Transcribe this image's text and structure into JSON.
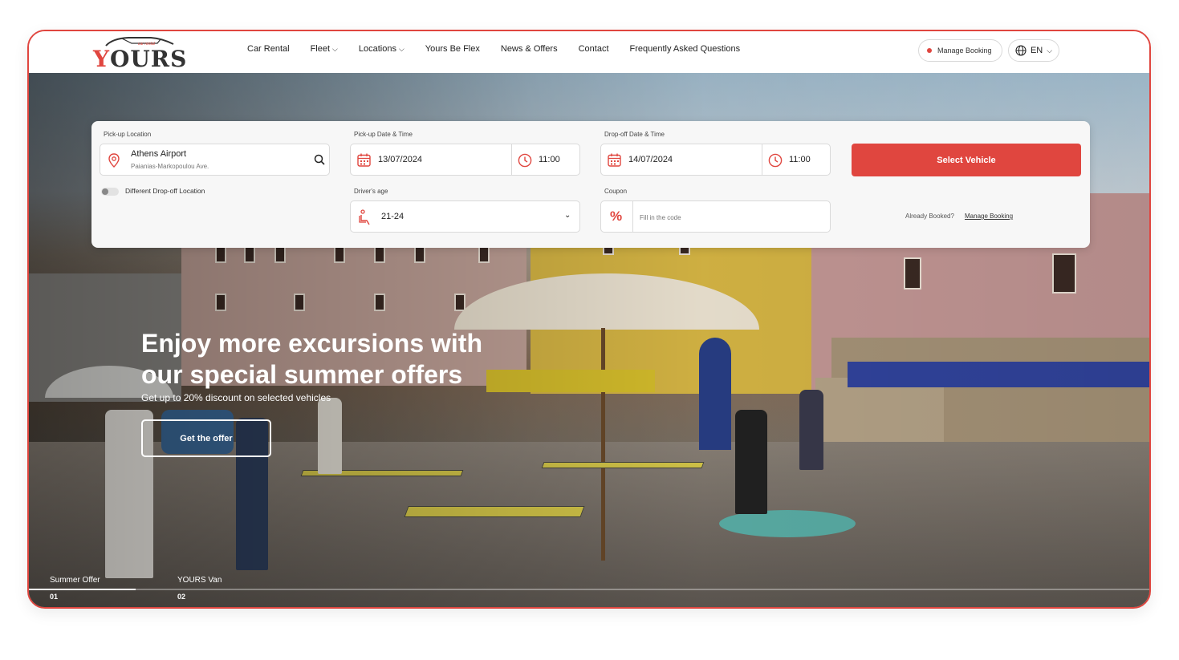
{
  "brand": {
    "name": "YOURS",
    "tagline": "car rental",
    "accent": "#e0463f"
  },
  "nav": {
    "items": [
      {
        "label": "Car Rental",
        "dropdown": false
      },
      {
        "label": "Fleet",
        "dropdown": true
      },
      {
        "label": "Locations",
        "dropdown": true
      },
      {
        "label": "Yours Be Flex",
        "dropdown": false
      },
      {
        "label": "News & Offers",
        "dropdown": false
      },
      {
        "label": "Contact",
        "dropdown": false
      },
      {
        "label": "Frequently Asked Questions",
        "dropdown": false
      }
    ],
    "manage_booking": "Manage Booking",
    "language": "EN"
  },
  "booking": {
    "pickup_label": "Pick-up Location",
    "pickup_value": "Athens Airport",
    "pickup_sub": "Paianias-Markopoulou Ave.",
    "pickup_date_label": "Pick-up Date & Time",
    "pickup_date": "13/07/2024",
    "pickup_time": "11:00",
    "dropoff_date_label": "Drop-off Date & Time",
    "dropoff_date": "14/07/2024",
    "dropoff_time": "11:00",
    "select_vehicle": "Select Vehicle",
    "different_dropoff": "Different Drop-off Location",
    "drivers_age_label": "Driver's age",
    "drivers_age": "21-24",
    "coupon_label": "Coupon",
    "coupon_placeholder": "Fill in the code",
    "already_booked": "Already Booked?",
    "manage_booking_link": "Manage Booking"
  },
  "hero": {
    "title": "Enjoy more excursions with our special summer offers",
    "subtitle": "Get up to 20% discount on selected vehicles",
    "cta": "Get the offer",
    "slides": [
      {
        "label": "Summer Offer",
        "num": "01"
      },
      {
        "label": "YOURS Van",
        "num": "02"
      }
    ]
  }
}
